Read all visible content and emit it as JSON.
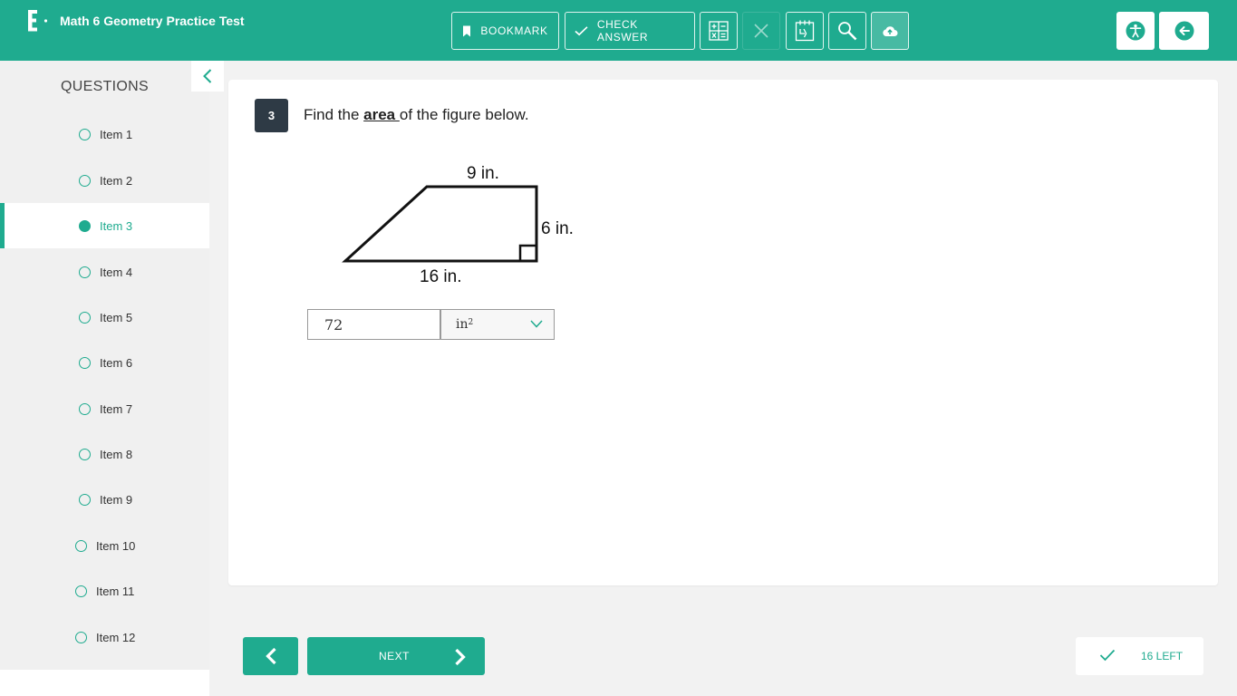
{
  "header": {
    "title": "Math 6 Geometry Practice Test",
    "bookmark_label": "BOOKMARK",
    "check_answer_label": "CHECK ANSWER"
  },
  "sidebar": {
    "title": "QUESTIONS",
    "items": [
      {
        "label": "Item 1"
      },
      {
        "label": "Item 2"
      },
      {
        "label": "Item 3"
      },
      {
        "label": "Item 4"
      },
      {
        "label": "Item 5"
      },
      {
        "label": "Item 6"
      },
      {
        "label": "Item 7"
      },
      {
        "label": "Item 8"
      },
      {
        "label": "Item 9"
      },
      {
        "label": "Item 10"
      },
      {
        "label": "Item 11"
      },
      {
        "label": "Item 12"
      }
    ],
    "active_index": 2
  },
  "question": {
    "number": "3",
    "prompt_before": "Find the ",
    "prompt_emphasis": "area ",
    "prompt_after": "of the figure below.",
    "figure": {
      "top_label": "9 in.",
      "right_label": "6 in.",
      "bottom_label": "16 in."
    },
    "answer_value": "72",
    "unit_base": "in",
    "unit_exponent": "2"
  },
  "footer": {
    "next_label": "NEXT",
    "remaining_label": "16 LEFT"
  },
  "colors": {
    "accent": "#1fab8f",
    "question_badge": "#2e3a45"
  }
}
